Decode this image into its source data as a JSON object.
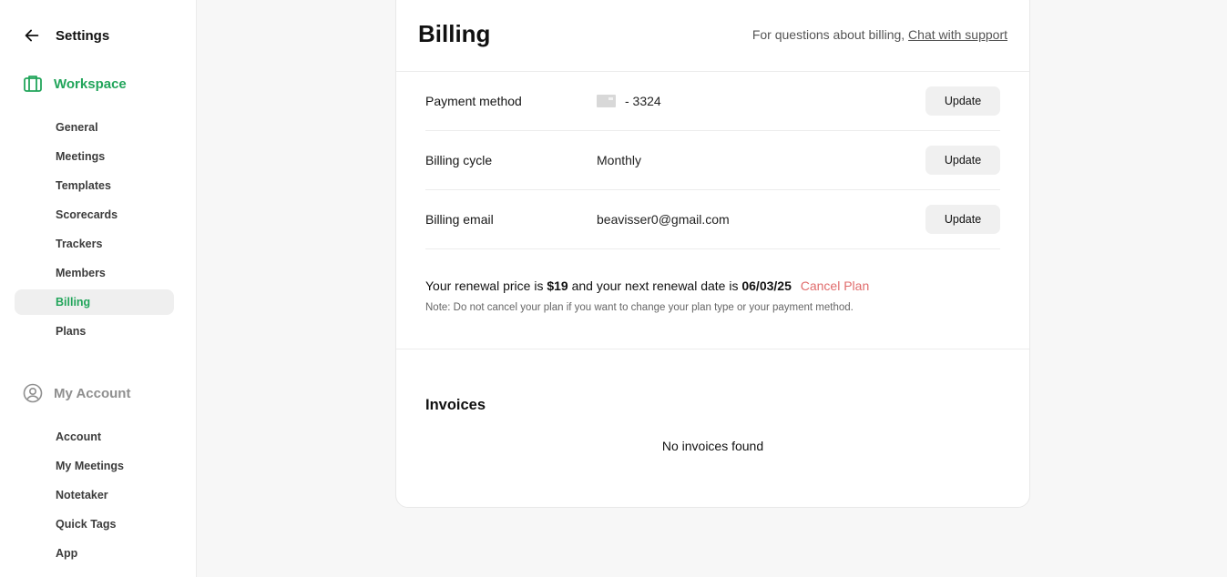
{
  "sidebar": {
    "back_title": "Settings",
    "workspace": {
      "label": "Workspace",
      "color": "#22a55b",
      "items": [
        {
          "label": "General"
        },
        {
          "label": "Meetings"
        },
        {
          "label": "Templates"
        },
        {
          "label": "Scorecards"
        },
        {
          "label": "Trackers"
        },
        {
          "label": "Members"
        },
        {
          "label": "Billing",
          "active": true
        },
        {
          "label": "Plans"
        }
      ]
    },
    "my_account": {
      "label": "My Account",
      "items": [
        {
          "label": "Account"
        },
        {
          "label": "My Meetings"
        },
        {
          "label": "Notetaker"
        },
        {
          "label": "Quick Tags"
        },
        {
          "label": "App"
        }
      ]
    }
  },
  "billing": {
    "title": "Billing",
    "support_text": "For questions about billing, ",
    "support_link": "Chat with support",
    "rows": [
      {
        "label": "Payment method",
        "value": "- 3324",
        "icon": "credit-card-icon",
        "button": "Update"
      },
      {
        "label": "Billing cycle",
        "value": "Monthly",
        "button": "Update"
      },
      {
        "label": "Billing email",
        "value": "beavisser0@gmail.com",
        "button": "Update"
      }
    ],
    "renewal": {
      "prefix": "Your renewal price is ",
      "price": "$19",
      "middle": " and your next renewal date is ",
      "date": "06/03/25",
      "cancel_label": "Cancel Plan",
      "cancel_color": "#e06c6c",
      "note": "Note: Do not cancel your plan if you want to change your plan type or your payment method."
    },
    "invoices": {
      "title": "Invoices",
      "empty": "No invoices found"
    }
  }
}
